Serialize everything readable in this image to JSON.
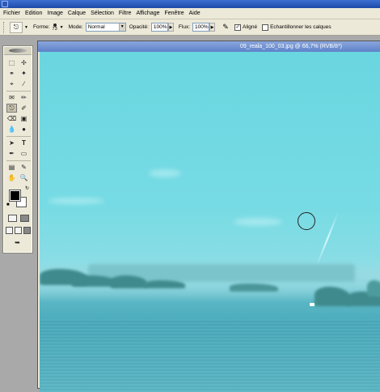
{
  "menu": [
    "Fichier",
    "Edition",
    "Image",
    "Calque",
    "Sélection",
    "Filtre",
    "Affichage",
    "Fenêtre",
    "Aide"
  ],
  "options": {
    "forme_label": "Forme:",
    "brush_size": "73",
    "mode_label": "Mode:",
    "mode_value": "Normal",
    "opacite_label": "Opacité:",
    "opacite_value": "100%",
    "flux_label": "Flux:",
    "flux_value": "100%",
    "aligne_checked": true,
    "aligne_label": "Aligné",
    "echantillonner_checked": false,
    "echantillonner_label": "Echantillonner les calques"
  },
  "document": {
    "title": "09_reala_100_03.jpg @ 66,7% (RVB/8*)"
  },
  "toolbox": {
    "foreground_color": "#000000",
    "background_color": "#ffffff",
    "active_tool": "clone-stamp-tool"
  },
  "colors": {
    "menu_bg": "#ece9d8",
    "title_bar": "#1c4aa8",
    "canvas_sky": "#6ad6e0",
    "canvas_sea": "#4aaabb"
  }
}
